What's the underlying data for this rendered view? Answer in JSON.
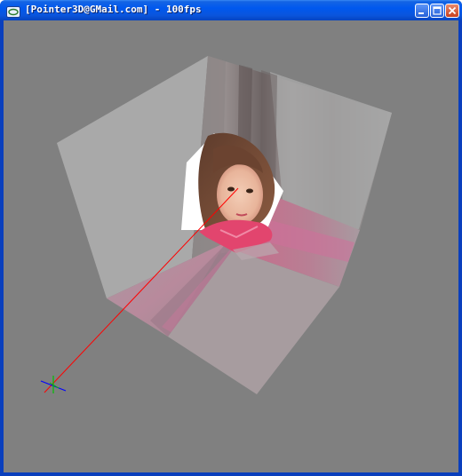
{
  "window": {
    "title": "[Pointer3D@GMail.com] - 100fps"
  },
  "title_controls": [
    {
      "name": "minimize-button",
      "icon": "minimize-icon"
    },
    {
      "name": "maximize-button",
      "icon": "maximize-icon"
    },
    {
      "name": "close-button",
      "icon": "close-icon"
    }
  ],
  "viewport": {
    "background_color": "#808080",
    "axis_colors": {
      "x": "#ff0000",
      "y": "#00c000",
      "z": "#0000ff"
    },
    "texture_subject": "photo-of-girl-face",
    "scene_icon": "textured-cube-interior"
  }
}
